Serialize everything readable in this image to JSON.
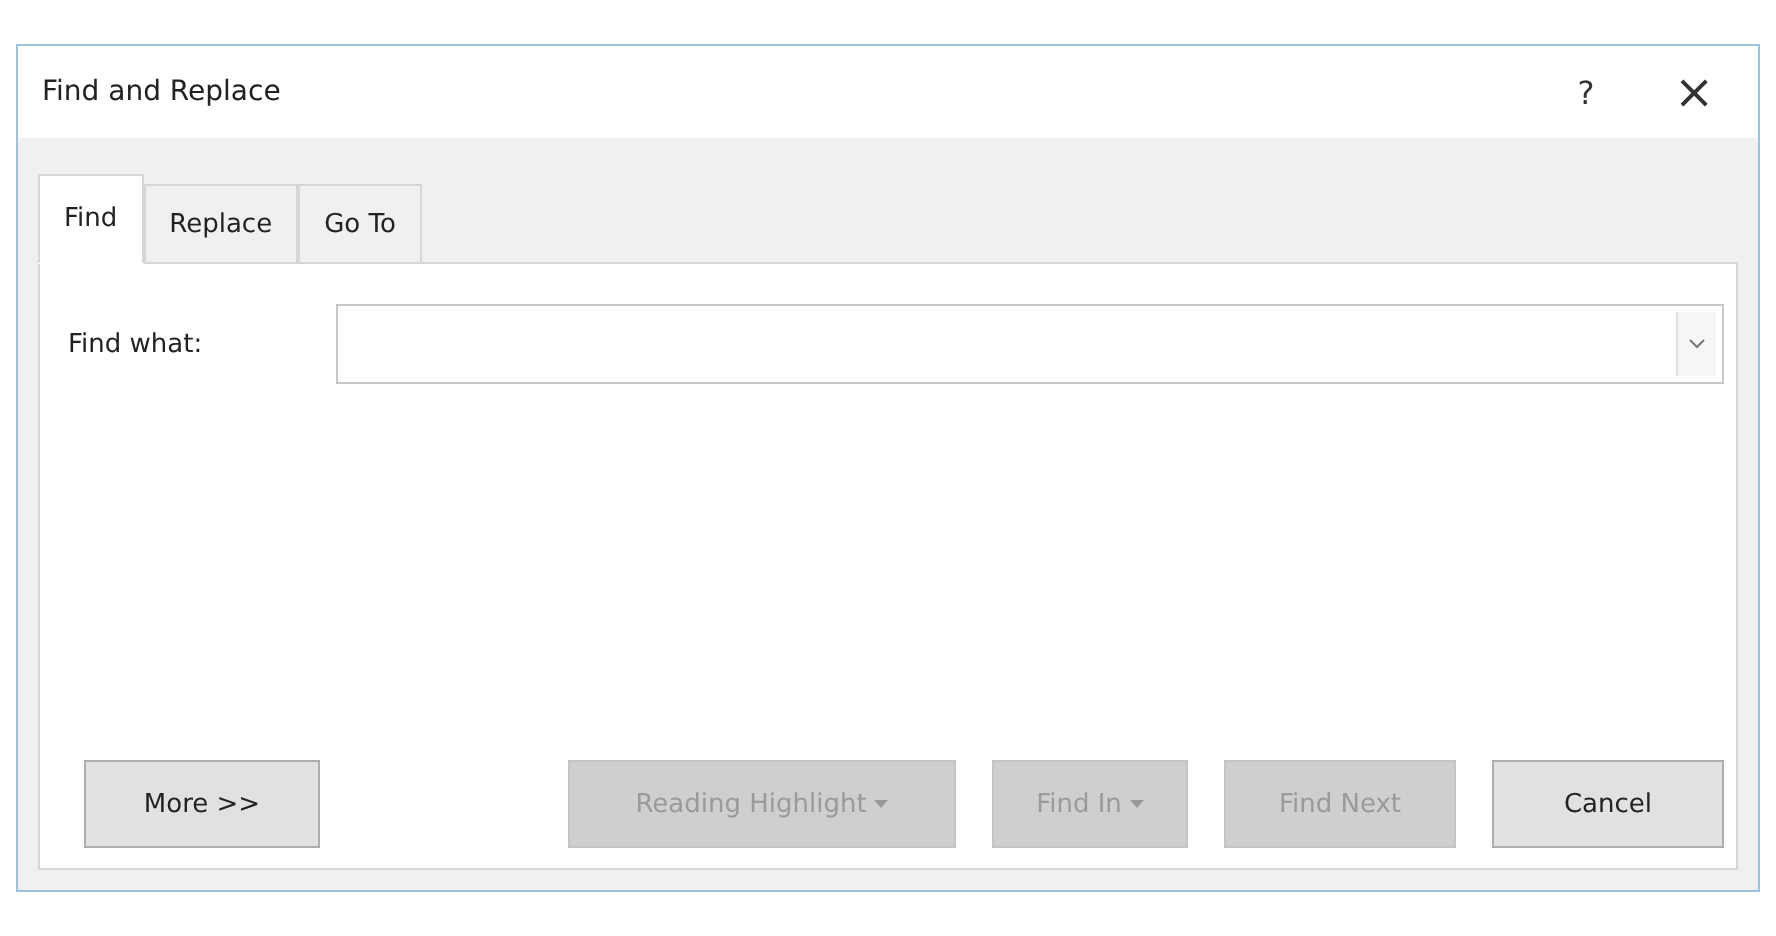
{
  "window": {
    "title": "Find and Replace",
    "help": "?",
    "close": "×"
  },
  "tabs": [
    {
      "label": "Find",
      "selected": true
    },
    {
      "label": "Replace",
      "selected": false
    },
    {
      "label": "Go To",
      "selected": false
    }
  ],
  "find_what": {
    "label": "Find what:"
  },
  "left_buttons": [
    {
      "label": "More >>",
      "disabled": false,
      "dropdown": false
    }
  ],
  "right_buttons": [
    {
      "label": "Reading Highlight",
      "disabled": true,
      "dropdown": true
    },
    {
      "label": "Find In",
      "disabled": true,
      "dropdown": true
    },
    {
      "label": "Find Next",
      "disabled": true,
      "dropdown": false
    },
    {
      "label": "Cancel",
      "disabled": false,
      "dropdown": false
    }
  ]
}
